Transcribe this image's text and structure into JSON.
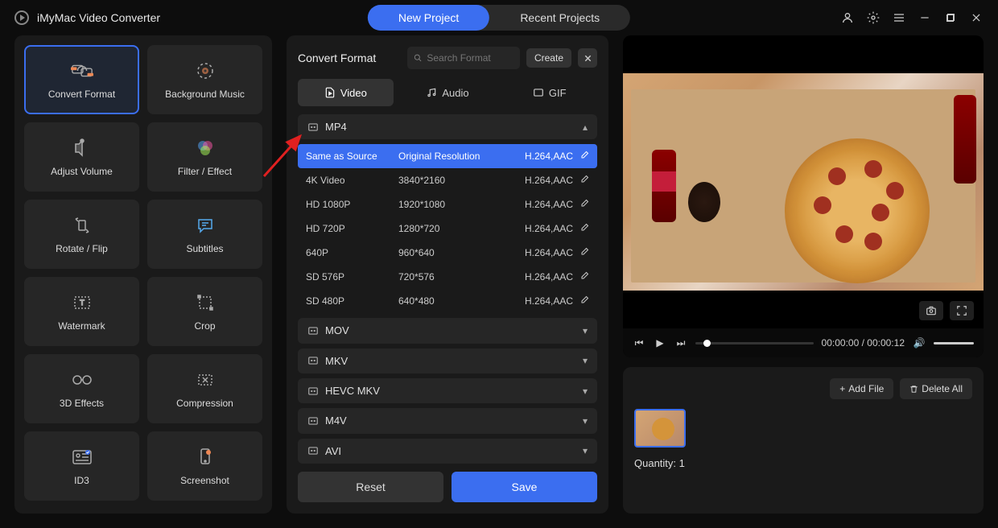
{
  "app": {
    "title": "iMyMac Video Converter"
  },
  "topTabs": {
    "new": "New Project",
    "recent": "Recent Projects"
  },
  "tools": [
    {
      "id": "convert-format",
      "label": "Convert Format",
      "selected": true
    },
    {
      "id": "background-music",
      "label": "Background Music"
    },
    {
      "id": "adjust-volume",
      "label": "Adjust Volume"
    },
    {
      "id": "filter-effect",
      "label": "Filter / Effect"
    },
    {
      "id": "rotate-flip",
      "label": "Rotate / Flip"
    },
    {
      "id": "subtitles",
      "label": "Subtitles"
    },
    {
      "id": "watermark",
      "label": "Watermark"
    },
    {
      "id": "crop",
      "label": "Crop"
    },
    {
      "id": "3d-effects",
      "label": "3D Effects"
    },
    {
      "id": "compression",
      "label": "Compression"
    },
    {
      "id": "id3",
      "label": "ID3"
    },
    {
      "id": "screenshot",
      "label": "Screenshot"
    }
  ],
  "center": {
    "title": "Convert Format",
    "searchPlaceholder": "Search Format",
    "createBtn": "Create",
    "tabs": {
      "video": "Video",
      "audio": "Audio",
      "gif": "GIF"
    },
    "activeTab": "video",
    "containers": [
      {
        "id": "mp4",
        "label": "MP4",
        "expanded": true,
        "presets": [
          {
            "name": "Same as Source",
            "res": "Original Resolution",
            "codec": "H.264,AAC",
            "selected": true
          },
          {
            "name": "4K Video",
            "res": "3840*2160",
            "codec": "H.264,AAC"
          },
          {
            "name": "HD 1080P",
            "res": "1920*1080",
            "codec": "H.264,AAC"
          },
          {
            "name": "HD 720P",
            "res": "1280*720",
            "codec": "H.264,AAC"
          },
          {
            "name": "640P",
            "res": "960*640",
            "codec": "H.264,AAC"
          },
          {
            "name": "SD 576P",
            "res": "720*576",
            "codec": "H.264,AAC"
          },
          {
            "name": "SD 480P",
            "res": "640*480",
            "codec": "H.264,AAC"
          }
        ]
      },
      {
        "id": "mov",
        "label": "MOV",
        "expanded": false
      },
      {
        "id": "mkv",
        "label": "MKV",
        "expanded": false
      },
      {
        "id": "hevc-mkv",
        "label": "HEVC MKV",
        "expanded": false
      },
      {
        "id": "m4v",
        "label": "M4V",
        "expanded": false
      },
      {
        "id": "avi",
        "label": "AVI",
        "expanded": false
      }
    ],
    "resetBtn": "Reset",
    "saveBtn": "Save"
  },
  "preview": {
    "currentTime": "00:00:00",
    "duration": "00:00:12"
  },
  "bottom": {
    "addFile": "Add File",
    "deleteAll": "Delete All",
    "quantityLabel": "Quantity:",
    "quantity": "1"
  }
}
